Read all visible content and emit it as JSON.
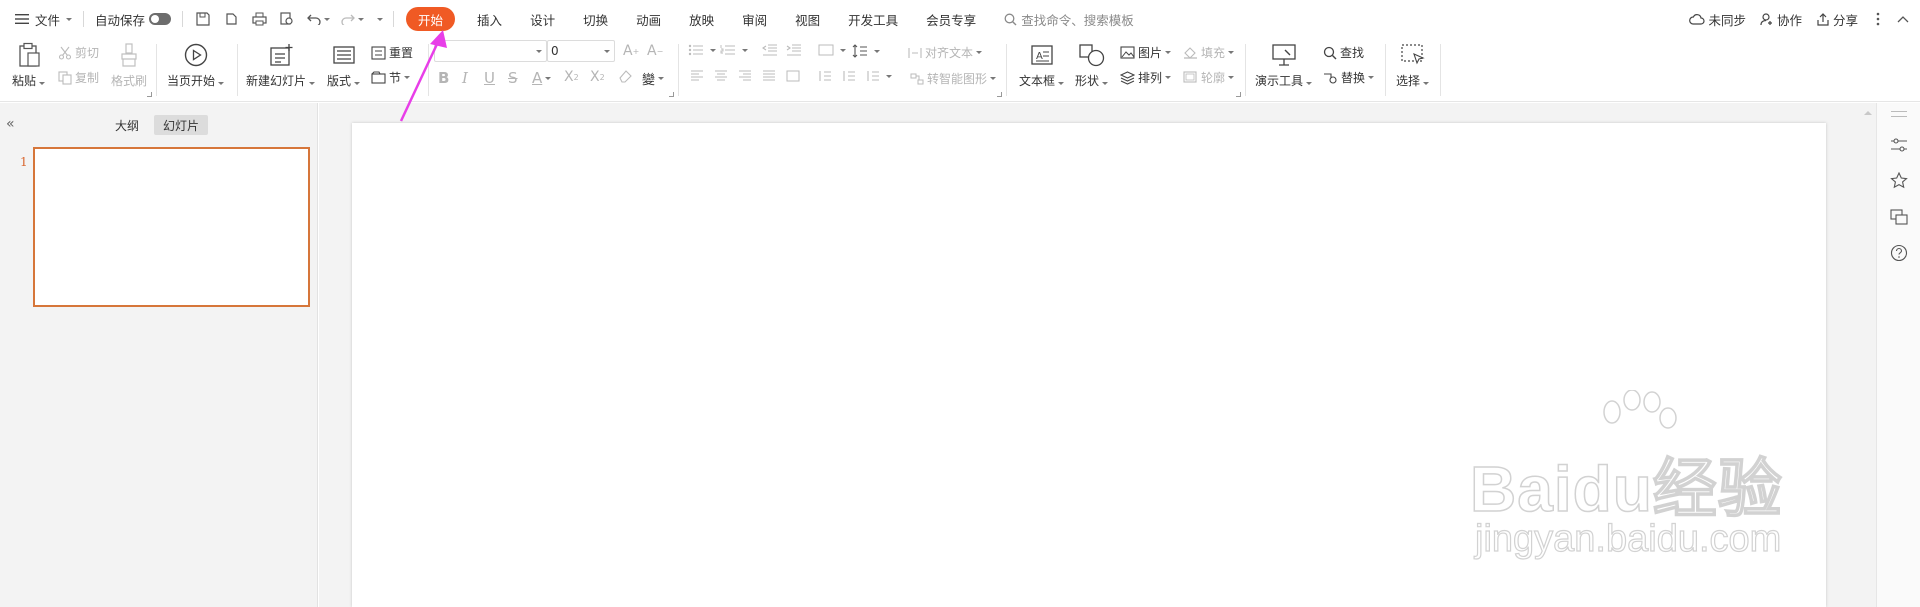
{
  "topbar": {
    "menu_label": "文件",
    "autosave_label": "自动保存",
    "tabs": [
      {
        "label": "开始",
        "active": true
      },
      {
        "label": "插入",
        "active": false
      },
      {
        "label": "设计",
        "active": false
      },
      {
        "label": "切换",
        "active": false
      },
      {
        "label": "动画",
        "active": false
      },
      {
        "label": "放映",
        "active": false
      },
      {
        "label": "审阅",
        "active": false
      },
      {
        "label": "视图",
        "active": false
      },
      {
        "label": "开发工具",
        "active": false
      },
      {
        "label": "会员专享",
        "active": false
      }
    ],
    "search_placeholder": "查找命令、搜索模板",
    "sync_label": "未同步",
    "collab_label": "协作",
    "share_label": "分享",
    "accent_color": "#f05a24"
  },
  "ribbon": {
    "paste": "粘贴",
    "cut": "剪切",
    "copy": "复制",
    "format_painter": "格式刷",
    "from_current": "当页开始",
    "new_slide": "新建幻灯片",
    "layout": "版式",
    "reset": "重置",
    "section": "节",
    "font_size_value": "0",
    "align_text": "对齐文本",
    "smartart": "转智能图形",
    "textbox": "文本框",
    "shape": "形状",
    "picture": "图片",
    "arrange": "排列",
    "fill": "填充",
    "outline": "轮廓",
    "presenter_tools": "演示工具",
    "find": "查找",
    "replace": "替换",
    "select": "选择"
  },
  "left_panel": {
    "tab_outline": "大纲",
    "tab_slides": "幻灯片",
    "slide_number": "1"
  },
  "watermark": {
    "main": "Baidu经验",
    "sub": "jingyan.baidu.com"
  },
  "annotation": {
    "arrow_color": "#e83ee8"
  }
}
